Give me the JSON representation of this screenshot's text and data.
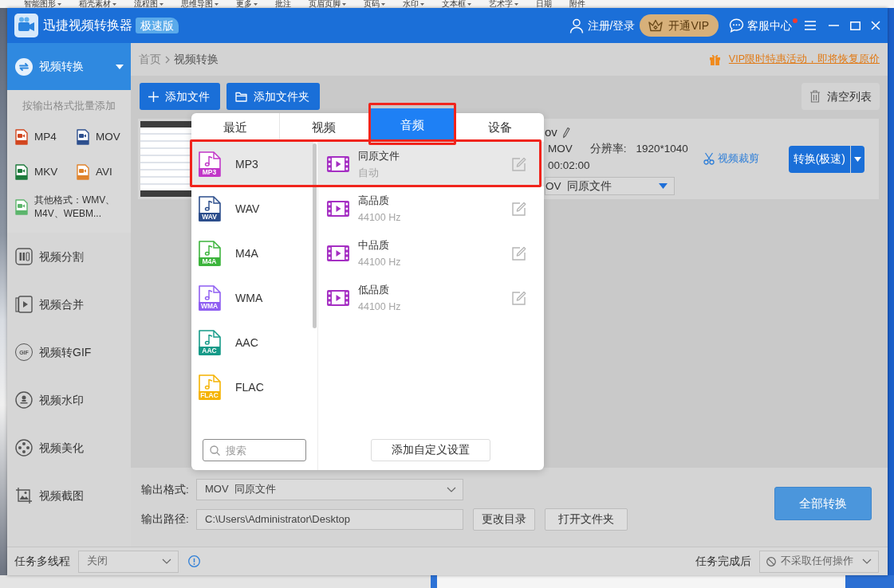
{
  "background": {
    "ribbon": [
      {
        "label": "智能图形",
        "dropdown": true
      },
      {
        "label": "稻壳素材",
        "dropdown": true
      },
      {
        "label": "流程图",
        "dropdown": true
      },
      {
        "label": "思维导图",
        "dropdown": true
      },
      {
        "label": "更多",
        "dropdown": true
      },
      {
        "label": "批注",
        "dropdown": false
      },
      {
        "label": "页眉页脚",
        "dropdown": true
      },
      {
        "label": "页码",
        "dropdown": true
      },
      {
        "label": "水印",
        "dropdown": true
      },
      {
        "label": "文本框",
        "dropdown": true
      },
      {
        "label": "艺术字",
        "dropdown": true
      },
      {
        "label": "日期",
        "dropdown": false
      },
      {
        "label": "附件",
        "dropdown": false
      }
    ]
  },
  "window": {
    "title": "迅捷视频转换器",
    "edition": "极速版",
    "login": "注册/登录",
    "vip": "开通VIP",
    "support": "客服中心",
    "support_notification": true
  },
  "sidebar": {
    "current": {
      "label": "视频转换",
      "expanded": true
    },
    "format_panel": {
      "hint": "按输出格式批量添加",
      "formats": [
        {
          "label": "MP4",
          "color": "#d2461f"
        },
        {
          "label": "MOV",
          "color": "#2d4f8e"
        },
        {
          "label": "MKV",
          "color": "#1d7a3c"
        },
        {
          "label": "AVI",
          "color": "#e0832b"
        },
        {
          "label": "其他格式：WMV、M4V、WEBM...",
          "color": "#5cb56c"
        }
      ]
    },
    "tools": [
      {
        "label": "视频分割",
        "kind": "split",
        "selected": false
      },
      {
        "label": "视频合并",
        "kind": "merge",
        "selected": false
      },
      {
        "label": "视频转GIF",
        "kind": "gif",
        "icon_text": "GIF",
        "selected": false
      },
      {
        "label": "视频水印",
        "kind": "watermark",
        "selected": false
      },
      {
        "label": "视频美化",
        "kind": "beautify",
        "selected": false
      },
      {
        "label": "视频截图",
        "kind": "screenshot",
        "selected": false
      }
    ]
  },
  "breadcrumb": {
    "items": [
      "首页",
      "视频转换"
    ],
    "promo": "VIP限时特惠活动，即将恢复原价"
  },
  "toolbar": {
    "add_file": "添加文件",
    "add_folder": "添加文件夹",
    "clear_list": "清空列表"
  },
  "file": {
    "name": "ov",
    "format": "MOV",
    "resolution_label": "分辨率:",
    "resolution": "1920*1040",
    "duration": "00:02:00",
    "output_format": "OV",
    "output_preset": "同原文件",
    "crop": "视频裁剪",
    "convert": "转换(极速)"
  },
  "format_popup": {
    "tabs": [
      {
        "label": "最近",
        "selected": false,
        "highlighted": false
      },
      {
        "label": "视频",
        "selected": false,
        "highlighted": false
      },
      {
        "label": "音频",
        "selected": true,
        "highlighted": true
      },
      {
        "label": "设备",
        "selected": false,
        "highlighted": false
      }
    ],
    "formats": [
      {
        "label": "MP3",
        "tag": "MP3",
        "color": "#c136c8",
        "selected": true,
        "highlighted": true
      },
      {
        "label": "WAV",
        "tag": "WAV",
        "color": "#2c4e8c",
        "selected": false,
        "highlighted": false
      },
      {
        "label": "M4A",
        "tag": "M4A",
        "color": "#3cb43c",
        "selected": false,
        "highlighted": false
      },
      {
        "label": "WMA",
        "tag": "WMA",
        "color": "#8f5ef2",
        "selected": false,
        "highlighted": false
      },
      {
        "label": "AAC",
        "tag": "AAC",
        "color": "#159a88",
        "selected": false,
        "highlighted": false
      },
      {
        "label": "FLAC",
        "tag": "FLAC",
        "color": "#f5b300",
        "selected": false,
        "highlighted": false
      }
    ],
    "presets": [
      {
        "title": "同原文件",
        "detail": "自动",
        "selected": true
      },
      {
        "title": "高品质",
        "detail": "44100 Hz",
        "selected": false
      },
      {
        "title": "中品质",
        "detail": "44100 Hz",
        "selected": false
      },
      {
        "title": "低品质",
        "detail": "44100 Hz",
        "selected": false
      }
    ],
    "search": {
      "placeholder": "搜索"
    },
    "add_custom": "添加自定义设置"
  },
  "output": {
    "format_label": "输出格式:",
    "format": "MOV",
    "preset": "同原文件",
    "path_label": "输出路径:",
    "path": "C:\\Users\\Administrator\\Desktop",
    "change_dir": "更改目录",
    "open_folder": "打开文件夹",
    "convert_all": "全部转换"
  },
  "status_bar": {
    "multithread_label": "任务多线程",
    "multithread": "关闭",
    "after_label": "任务完成后",
    "after": "不采取任何操作"
  }
}
